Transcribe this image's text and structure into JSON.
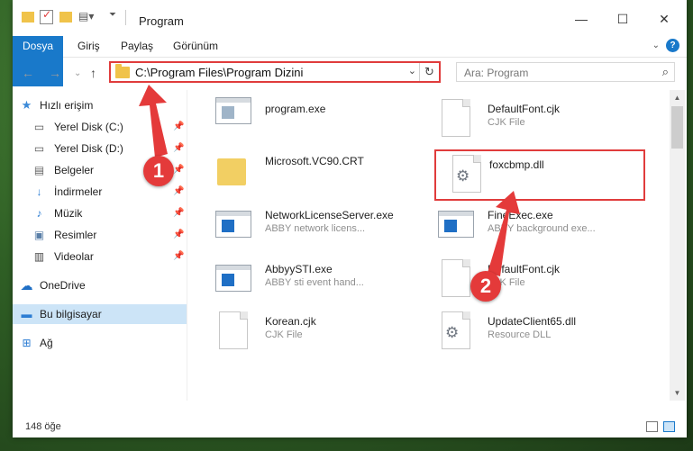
{
  "window": {
    "title": "Program",
    "controls": {
      "minimize": "—",
      "maximize": "☐",
      "close": "✕"
    }
  },
  "ribbon": {
    "tabs": [
      "Dosya",
      "Giriş",
      "Paylaş",
      "Görünüm"
    ],
    "expand": "⌄",
    "help": "?"
  },
  "nav": {
    "back": "←",
    "forward": "→",
    "recent": "⌄",
    "up": "↑",
    "address": "C:\\Program Files\\Program Dizini",
    "address_dropdown": "⌄",
    "refresh": "↻",
    "search_placeholder": "Ara: Program"
  },
  "sidebar": {
    "items": [
      {
        "label": "Hızlı erişim",
        "icon": "star-icon",
        "pinned": false
      },
      {
        "label": "Yerel Disk (C:)",
        "icon": "drive-icon",
        "pinned": true
      },
      {
        "label": "Yerel Disk (D:)",
        "icon": "drive-icon",
        "pinned": true
      },
      {
        "label": "Belgeler",
        "icon": "document-icon",
        "pinned": true
      },
      {
        "label": "İndirmeler",
        "icon": "download-icon",
        "pinned": true
      },
      {
        "label": "Müzik",
        "icon": "music-icon",
        "pinned": true
      },
      {
        "label": "Resimler",
        "icon": "picture-icon",
        "pinned": true
      },
      {
        "label": "Videolar",
        "icon": "video-icon",
        "pinned": true
      },
      {
        "label": "OneDrive",
        "icon": "cloud-icon",
        "pinned": false
      },
      {
        "label": "Bu bilgisayar",
        "icon": "computer-icon",
        "pinned": false,
        "selected": true
      },
      {
        "label": "Ağ",
        "icon": "network-icon",
        "pinned": false
      }
    ],
    "pin_glyph": "📌"
  },
  "files": [
    {
      "name": "program.exe",
      "desc": "",
      "type": "exe"
    },
    {
      "name": "DefaultFont.cjk",
      "desc": "CJK File",
      "type": "doc"
    },
    {
      "name": "Microsoft.VC90.CRT",
      "desc": "",
      "type": "folder"
    },
    {
      "name": "foxcbmp.dll",
      "desc": "",
      "type": "dll"
    },
    {
      "name": "NetworkLicenseServer.exe",
      "desc": "ABBY network licens...",
      "type": "exe"
    },
    {
      "name": "FineExec.exe",
      "desc": "ABBY background exe...",
      "type": "exe"
    },
    {
      "name": "AbbyySTI.exe",
      "desc": "ABBY sti event hand...",
      "type": "exe"
    },
    {
      "name": "DefaultFont.cjk",
      "desc": "CJK File",
      "type": "doc"
    },
    {
      "name": "Korean.cjk",
      "desc": "CJK File",
      "type": "doc"
    },
    {
      "name": "UpdateClient65.dll",
      "desc": "Resource DLL",
      "type": "dll"
    }
  ],
  "status": {
    "item_count": "148 öğe"
  },
  "annotations": {
    "badge_1": "1",
    "badge_2": "2",
    "accent_color": "#e43a3a"
  }
}
